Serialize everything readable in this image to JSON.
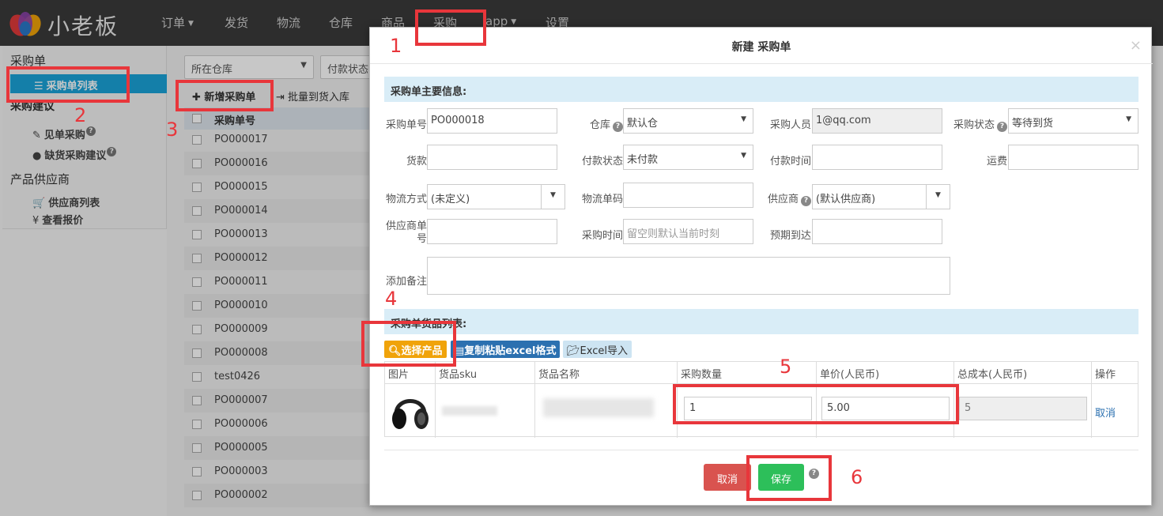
{
  "app": {
    "logo_text": "小老板"
  },
  "nav": {
    "items": [
      "订单",
      "发货",
      "物流",
      "仓库",
      "商品",
      "采购",
      "app",
      "设置"
    ]
  },
  "sidebar": {
    "purchase_order": "采购单",
    "po_list": "采购单列表",
    "purchase_suggest": "采购建议",
    "order_based": "见单采购",
    "shortage_suggest": "缺货采购建议",
    "supplier_section": "产品供应商",
    "supplier_list": "供应商列表",
    "view_quotes": "查看报价"
  },
  "main": {
    "filter_warehouse": "所在仓库",
    "filter_payment": "付款状态",
    "new_po": "新增采购单",
    "batch_stockin": "批量到货入库",
    "list_header": "采购单号",
    "rows": [
      "PO000017",
      "PO000016",
      "PO000015",
      "PO000014",
      "PO000013",
      "PO000012",
      "PO000011",
      "PO000010",
      "PO000009",
      "PO000008",
      "test0426",
      "PO000007",
      "PO000006",
      "PO000005",
      "PO000003",
      "PO000002"
    ]
  },
  "modal": {
    "title": "新建 采购单",
    "close": "×",
    "main_info_header": "采购单主要信息:",
    "fields": {
      "po_no_label": "采购单号",
      "po_no_value": "PO000018",
      "warehouse_label": "仓库",
      "warehouse_value": "默认仓",
      "buyer_label": "采购人员",
      "buyer_value": "1@qq.com",
      "status_label": "采购状态",
      "status_value": "等待到货",
      "goods_amount_label": "货款",
      "pay_status_label": "付款状态",
      "pay_status_value": "未付款",
      "pay_time_label": "付款时间",
      "freight_label": "运费",
      "logistics_label": "物流方式",
      "logistics_value": "(未定义)",
      "tracking_label": "物流单码",
      "supplier_label": "供应商",
      "supplier_value": "(默认供应商)",
      "supplier_no_label_1": "供应商单",
      "supplier_no_label_2": "号",
      "purchase_time_label": "采购时间",
      "purchase_time_placeholder": "留空则默认当前时刻",
      "eta_label": "预期到达",
      "remark_label": "添加备注"
    },
    "goods_header": "采购单货品列表:",
    "btn_select_product": "选择产品",
    "btn_copy_excel": "复制粘贴excel格式",
    "btn_excel_import": "Excel导入",
    "table": {
      "headers": [
        "图片",
        "货品sku",
        "货品名称",
        "采购数量",
        "单价(人民币)",
        "总成本(人民币)",
        "操作"
      ],
      "row": {
        "qty": "1",
        "price": "5.00",
        "total": "5",
        "action": "取消"
      }
    },
    "btn_cancel": "取消",
    "btn_save": "保存"
  },
  "annotations": [
    "1",
    "2",
    "3",
    "4",
    "5",
    "6"
  ],
  "colors": {
    "accent": "#1aa3d9",
    "annotation": "#e8363b",
    "save": "#2dbf5a",
    "cancel": "#d9534f",
    "select": "#f0a30a"
  }
}
